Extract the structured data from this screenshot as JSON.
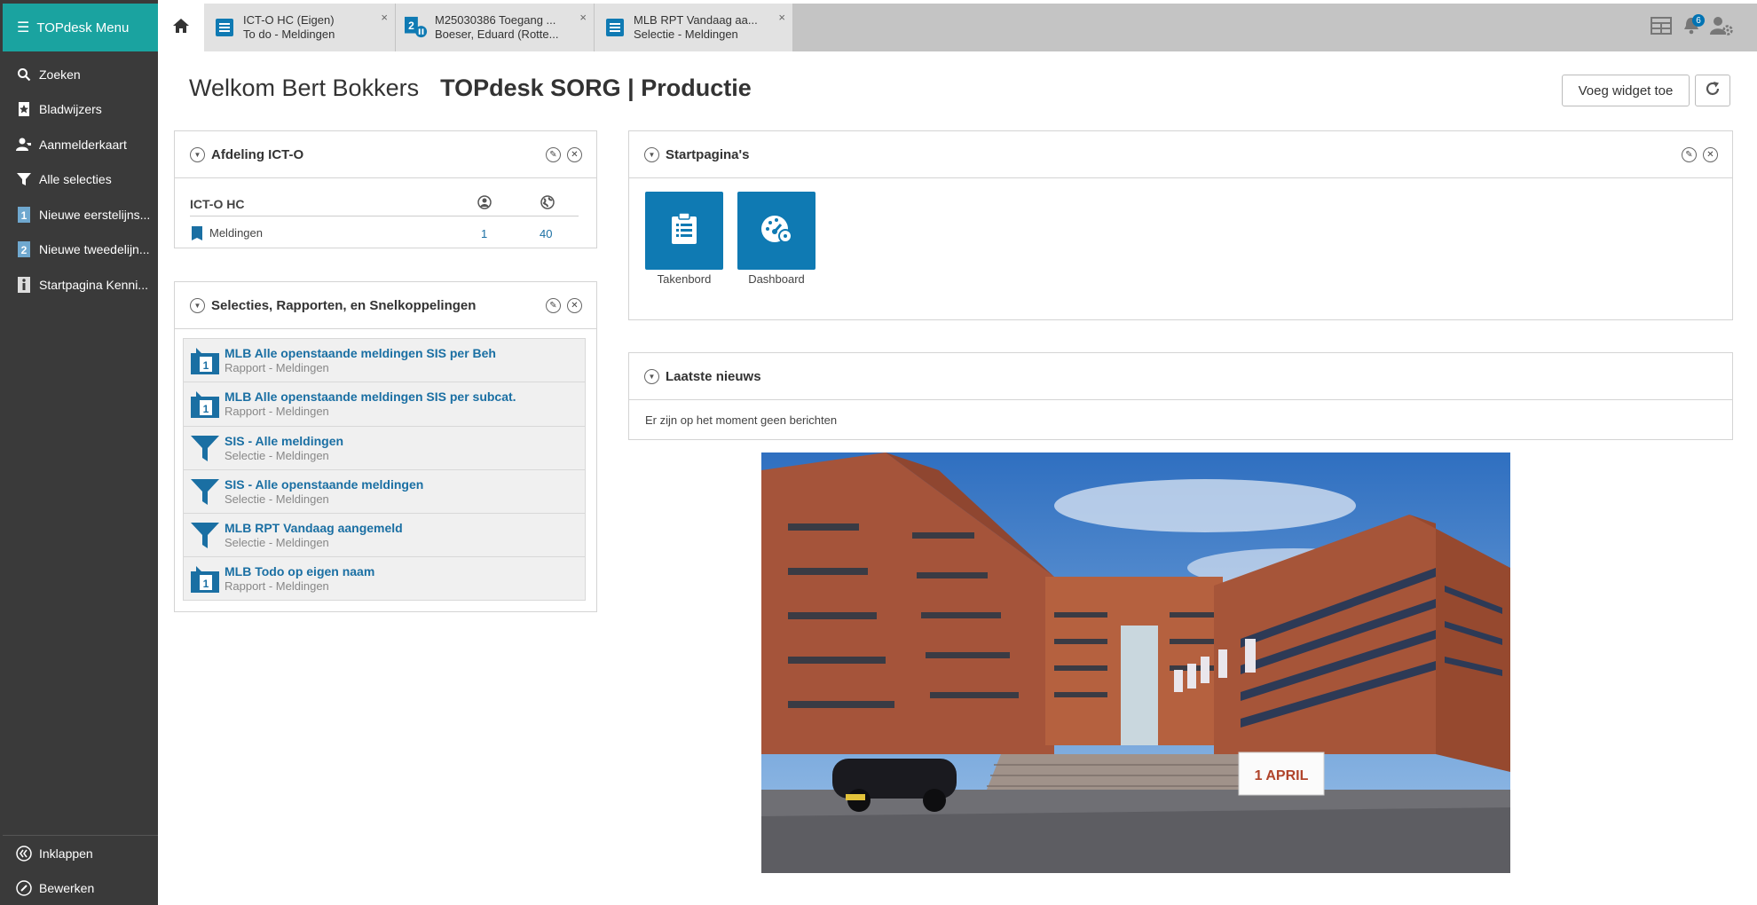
{
  "sidebar": {
    "menu_label": "TOPdesk Menu",
    "items": [
      {
        "label": "Zoeken",
        "icon": "search-icon"
      },
      {
        "label": "Bladwijzers",
        "icon": "bookmark-icon"
      },
      {
        "label": "Aanmelderkaart",
        "icon": "caller-card-icon"
      },
      {
        "label": "Alle selecties",
        "icon": "filter-icon"
      },
      {
        "label": "Nieuwe eerstelijns...",
        "icon": "first-line-icon"
      },
      {
        "label": "Nieuwe tweedelijn...",
        "icon": "second-line-icon"
      },
      {
        "label": "Startpagina Kenni...",
        "icon": "knowledge-icon"
      }
    ],
    "bottom_items": [
      {
        "label": "Inklappen",
        "icon": "collapse-icon"
      },
      {
        "label": "Bewerken",
        "icon": "edit-icon"
      }
    ]
  },
  "tabs": [
    {
      "line1": "ICT-O HC (Eigen)",
      "line2": "To do - Meldingen",
      "close": "×"
    },
    {
      "line1": "M25030386 Toegang ...",
      "line2": "Boeser, Eduard (Rotte...",
      "close": "×"
    },
    {
      "line1": "MLB RPT Vandaag aa...",
      "line2": "Selectie - Meldingen",
      "close": "×"
    }
  ],
  "topbar": {
    "notification_count": "6"
  },
  "header": {
    "welcome": "Welkom Bert Bokkers",
    "environment": "TOPdesk SORG | Productie",
    "add_widget": "Voeg widget toe"
  },
  "widgets": {
    "afdeling": {
      "title": "Afdeling ICT-O",
      "group": "ICT-O HC",
      "row_label": "Meldingen",
      "row_val1": "1",
      "row_val2": "40"
    },
    "selecties": {
      "title": "Selecties, Rapporten, en Snelkoppelingen",
      "items": [
        {
          "title": "MLB Alle openstaande meldingen SIS per Beh",
          "sub": "Rapport - Meldingen",
          "type": "report"
        },
        {
          "title": "MLB Alle openstaande meldingen SIS per subcat.",
          "sub": "Rapport - Meldingen",
          "type": "report"
        },
        {
          "title": "SIS - Alle meldingen",
          "sub": "Selectie - Meldingen",
          "type": "selection"
        },
        {
          "title": "SIS - Alle openstaande meldingen",
          "sub": "Selectie - Meldingen",
          "type": "selection"
        },
        {
          "title": "MLB RPT Vandaag aangemeld",
          "sub": "Selectie - Meldingen",
          "type": "selection"
        },
        {
          "title": "MLB Todo op eigen naam",
          "sub": "Rapport - Meldingen",
          "type": "report"
        }
      ]
    },
    "startpaginas": {
      "title": "Startpagina's",
      "tiles": [
        {
          "label": "Takenbord",
          "icon": "clipboard-icon"
        },
        {
          "label": "Dashboard",
          "icon": "dashboard-icon"
        }
      ]
    },
    "nieuws": {
      "title": "Laatste nieuws",
      "message": "Er zijn op het moment geen berichten"
    }
  },
  "photo": {
    "sign_text": "1 APRIL"
  },
  "colors": {
    "accent": "#1aa3a0",
    "link": "#1a6fa3",
    "tile": "#0f7ab3",
    "sidebar": "#3a3a3a"
  }
}
